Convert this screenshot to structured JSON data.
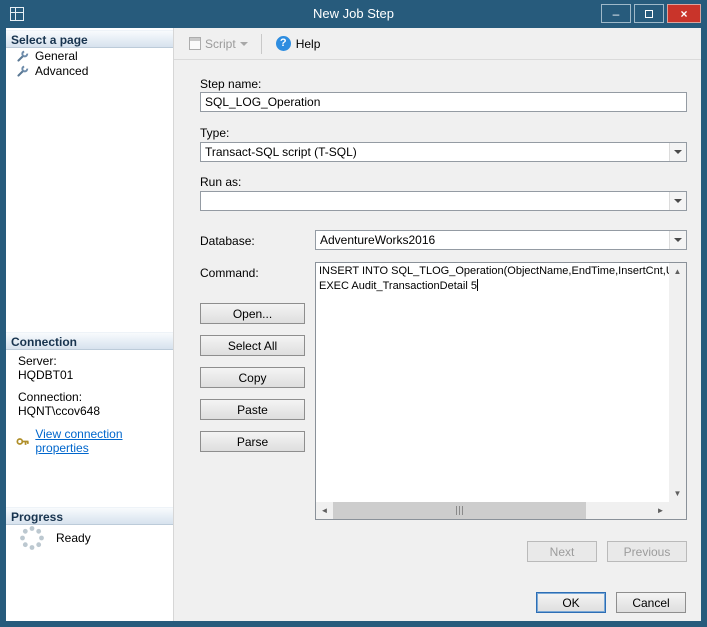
{
  "window": {
    "title": "New Job Step",
    "controls": {
      "minimize": "–",
      "close": "×"
    }
  },
  "sidebar": {
    "select_page": {
      "header": "Select a page",
      "items": [
        {
          "label": "General"
        },
        {
          "label": "Advanced"
        }
      ]
    },
    "connection": {
      "header": "Connection",
      "server_label": "Server:",
      "server_value": "HQDBT01",
      "connection_label": "Connection:",
      "connection_value": "HQNT\\ccov648",
      "link": "View connection properties"
    },
    "progress": {
      "header": "Progress",
      "status": "Ready"
    }
  },
  "toolbar": {
    "script": "Script",
    "help": "Help",
    "help_glyph": "?"
  },
  "form": {
    "step_name": {
      "label": "Step name:",
      "value": "SQL_LOG_Operation"
    },
    "type": {
      "label": "Type:",
      "value": "Transact-SQL script (T-SQL)"
    },
    "run_as": {
      "label": "Run as:",
      "value": ""
    },
    "database": {
      "label": "Database:",
      "value": "AdventureWorks2016"
    },
    "command": {
      "label": "Command:",
      "lines": [
        "INSERT INTO SQL_TLOG_Operation(ObjectName,EndTime,InsertCnt,U",
        "EXEC Audit_TransactionDetail 5"
      ]
    },
    "command_buttons": [
      "Open...",
      "Select All",
      "Copy",
      "Paste",
      "Parse"
    ]
  },
  "wizard": {
    "next": "Next",
    "previous": "Previous"
  },
  "footer": {
    "ok": "OK",
    "cancel": "Cancel"
  },
  "colors": {
    "titlebar": "#275b7c",
    "close_button": "#c9342a",
    "link": "#0066cc",
    "help_icon": "#2e8de0"
  }
}
